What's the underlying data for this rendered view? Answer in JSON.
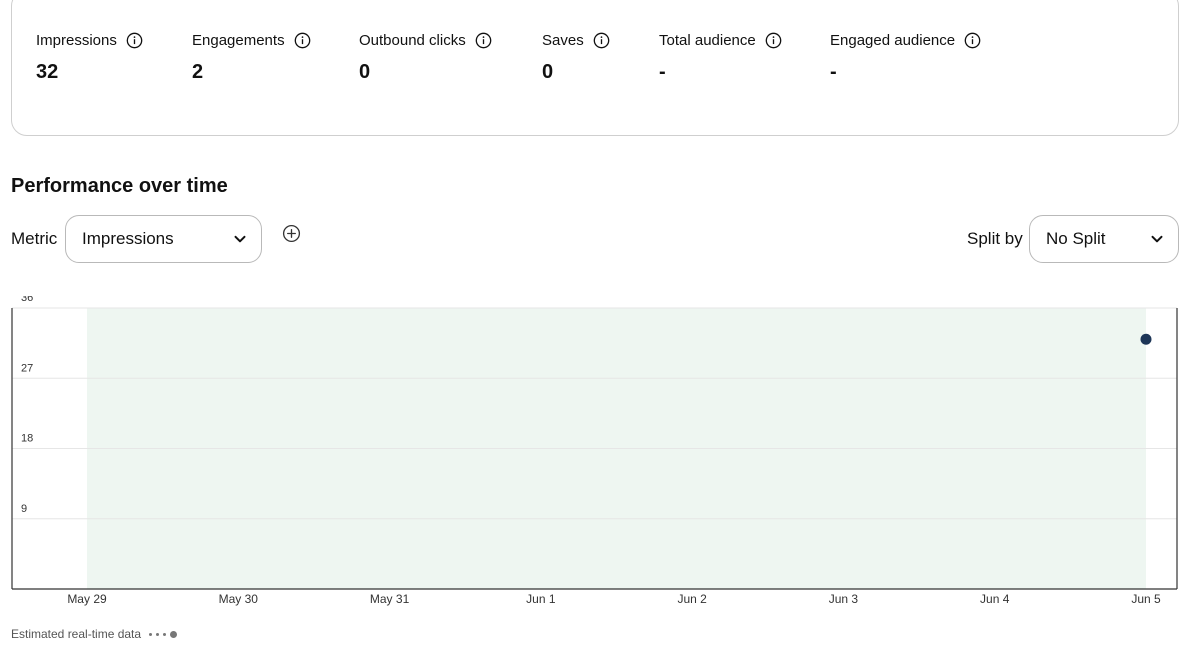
{
  "metrics": [
    {
      "label": "Impressions",
      "value": "32"
    },
    {
      "label": "Engagements",
      "value": "2"
    },
    {
      "label": "Outbound clicks",
      "value": "0"
    },
    {
      "label": "Saves",
      "value": "0"
    },
    {
      "label": "Total audience",
      "value": "-"
    },
    {
      "label": "Engaged audience",
      "value": "-"
    }
  ],
  "section": {
    "title": "Performance over time"
  },
  "controls": {
    "metric_label": "Metric",
    "metric_value": "Impressions",
    "split_label": "Split by",
    "split_value": "No Split"
  },
  "chart_data": {
    "type": "scatter",
    "categories": [
      "May 29",
      "May 30",
      "May 31",
      "Jun 1",
      "Jun 2",
      "Jun 3",
      "Jun 4",
      "Jun 5"
    ],
    "series": [
      {
        "values": [
          null,
          null,
          null,
          null,
          null,
          null,
          null,
          32
        ]
      }
    ],
    "y_ticks": [
      9,
      18,
      27,
      36
    ],
    "ylim": [
      0,
      36
    ],
    "grid": true,
    "shaded_range": [
      "May 29",
      "Jun 5"
    ],
    "colors": {
      "point": "#1d3557",
      "shade": "#eef6f1",
      "grid": "#e6e6e6",
      "axis": "#333333"
    }
  },
  "footer": {
    "note": "Estimated real-time data"
  },
  "icons": {
    "info": "info-circle-icon",
    "add": "plus-circle-icon",
    "chevron": "chevron-down-icon"
  }
}
